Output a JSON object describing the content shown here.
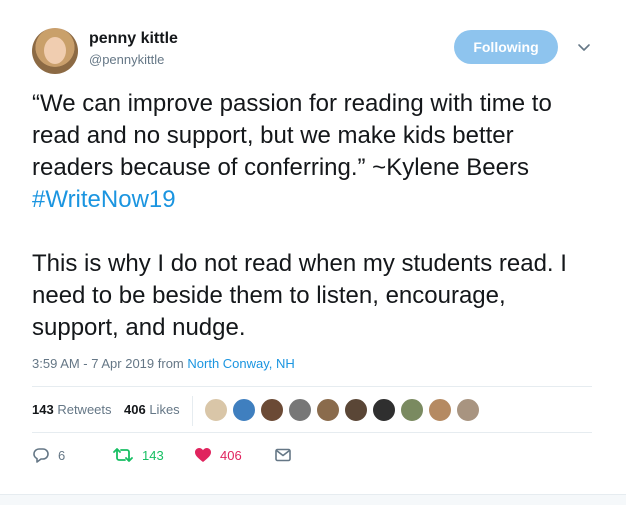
{
  "user": {
    "name": "penny kittle",
    "handle": "@pennykittle",
    "follow_label": "Following"
  },
  "tweet": {
    "paragraph1_text": "“We can improve passion for reading with time to read and no support, but we make kids better readers because of conferring.” ~Kylene Beers ",
    "hashtag": "#WriteNow19",
    "paragraph2_text": "This is why I do not read when my students read. I need to be beside them to listen, encourage, support, and nudge."
  },
  "meta": {
    "timestamp": "3:59 AM - 7 Apr 2019",
    "from_label": "from",
    "location": "North Conway, NH"
  },
  "stats": {
    "retweets_count": "143",
    "retweets_label": "Retweets",
    "likes_count": "406",
    "likes_label": "Likes"
  },
  "actions": {
    "reply_count": "6",
    "retweet_count": "143",
    "like_count": "406"
  },
  "colors": {
    "link": "#1b95e0",
    "follow_button": "#8ec4ee",
    "retweet": "#17bf63",
    "like": "#e0245e",
    "muted": "#657786"
  },
  "icons": [
    "chevron-down-icon",
    "reply-icon",
    "retweet-icon",
    "heart-icon",
    "direct-message-icon"
  ]
}
